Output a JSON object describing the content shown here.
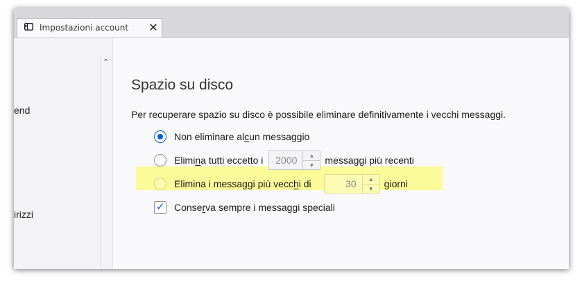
{
  "tab": {
    "icon": "settings-tab-icon",
    "title": "Impostazioni account",
    "close_symbol": "✕"
  },
  "sidebar": {
    "items": [
      {
        "label": "end"
      },
      {
        "label": "irizzi"
      }
    ],
    "scroll_up_symbol": "⌃"
  },
  "main": {
    "section_title": "Spazio su disco",
    "description": "Per recuperare spazio su disco è possibile eliminare definitivamente i vecchi messaggi.",
    "options": {
      "no_delete": {
        "label_pre": "Non eliminare al",
        "access_key": "c",
        "label_post": "un messaggio",
        "selected": true
      },
      "keep_recent": {
        "label_pre": "Elimi",
        "access_key": "n",
        "label_mid": "a tutti eccetto i",
        "value": "2000",
        "label_post": "messaggi più recenti",
        "selected": false
      },
      "delete_older": {
        "label_pre": "Elimina i messaggi più vecc",
        "access_key": "h",
        "label_mid": "i di",
        "value": "30",
        "label_post": "giorni",
        "selected": false,
        "highlighted": true
      },
      "keep_starred": {
        "label_pre": "Conse",
        "access_key": "r",
        "label_post": "va sempre i messaggi speciali",
        "checked": true
      }
    }
  },
  "colors": {
    "accent": "#0061e0",
    "highlight": "#fbfb99"
  }
}
